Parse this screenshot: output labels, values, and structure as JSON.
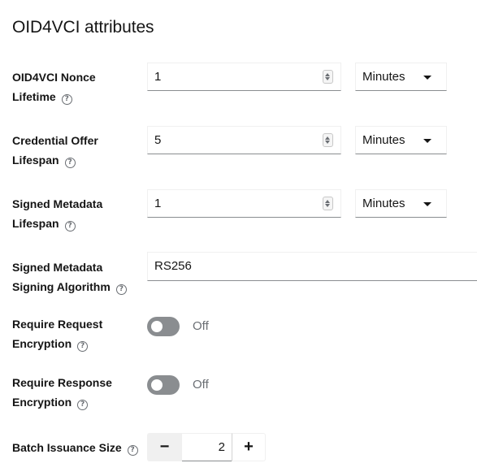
{
  "section": {
    "title": "OID4VCI attributes"
  },
  "fields": {
    "nonce_lifetime": {
      "label_line1": "OID4VCI Nonce",
      "label_line2": "Lifetime",
      "value": "1",
      "unit": "Minutes",
      "help_icon": "help-circle-icon"
    },
    "credential_offer_lifespan": {
      "label_line1": "Credential Offer",
      "label_line2": "Lifespan",
      "value": "5",
      "unit": "Minutes",
      "help_icon": "help-circle-icon"
    },
    "signed_metadata_lifespan": {
      "label_line1": "Signed Metadata",
      "label_line2": "Lifespan",
      "value": "1",
      "unit": "Minutes",
      "help_icon": "help-circle-icon"
    },
    "signed_metadata_signing_algorithm": {
      "label_line1": "Signed Metadata",
      "label_line2": "Signing Algorithm",
      "value": "RS256",
      "help_icon": "help-circle-icon"
    },
    "require_request_encryption": {
      "label_line1": "Require Request",
      "label_line2": "Encryption",
      "state_text": "Off",
      "checked": false,
      "help_icon": "help-circle-icon"
    },
    "require_response_encryption": {
      "label_line1": "Require Response",
      "label_line2": "Encryption",
      "state_text": "Off",
      "checked": false,
      "help_icon": "help-circle-icon"
    },
    "batch_issuance_size": {
      "label": "Batch Issuance Size",
      "value": "2",
      "minus_label": "−",
      "plus_label": "+",
      "help_icon": "help-circle-icon"
    }
  },
  "colors": {
    "text": "#151515",
    "muted": "#6a6e73",
    "toggle_off": "#8a8d90",
    "input_border_bottom": "#8a8d90",
    "stepper_bg": "#f0f0f0"
  }
}
